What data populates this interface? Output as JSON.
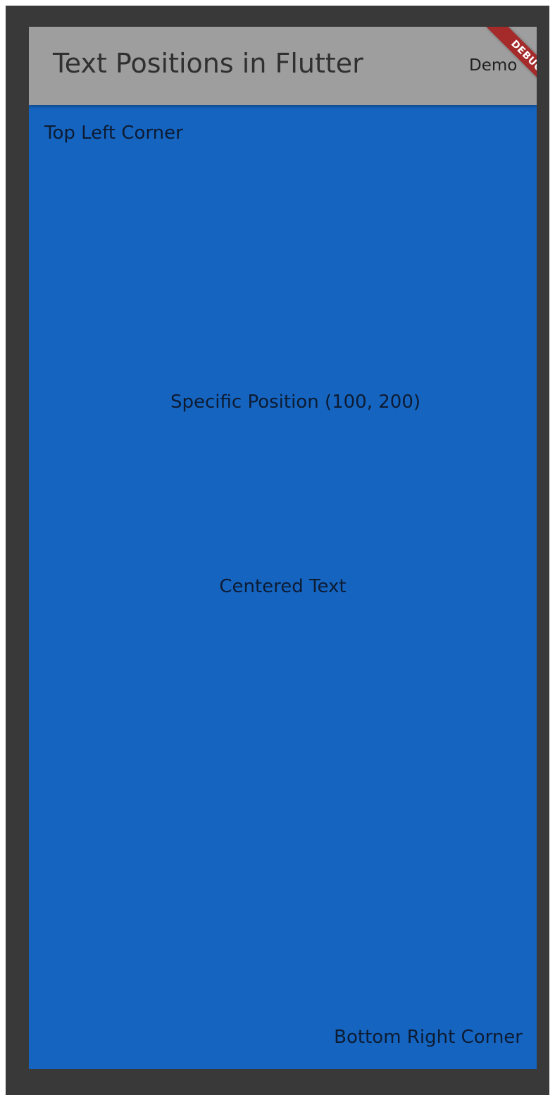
{
  "appbar": {
    "title": "Text Positions in Flutter",
    "action_label": "Demo",
    "background": "#9e9e9e"
  },
  "debug_banner": {
    "label": "DEBUG",
    "color": "#a52a2a"
  },
  "body": {
    "background": "#1565c0",
    "top_left_text": "Top Left Corner",
    "specific_position_text": "Specific Position (100, 200)",
    "centered_text": "Centered Text",
    "bottom_right_text": "Bottom Right Corner"
  }
}
